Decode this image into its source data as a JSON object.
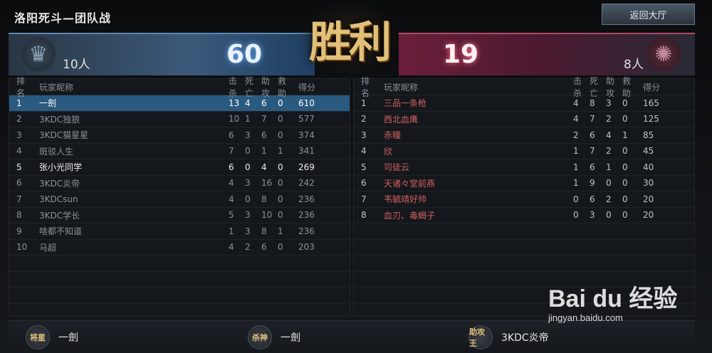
{
  "header": {
    "title": "洛阳死斗—团队战",
    "back_label": "返回大厅",
    "result": "胜利"
  },
  "teams": {
    "blue": {
      "players": "10人",
      "score": "60"
    },
    "red": {
      "players": "8人",
      "score": "19"
    }
  },
  "columns": {
    "rank": "排名",
    "name": "玩家昵称",
    "kills": "击杀",
    "deaths": "死亡",
    "assists": "助攻",
    "rescues": "救助",
    "score": "得分"
  },
  "blue_rows": [
    {
      "rank": "1",
      "name": "一劍",
      "k": "13",
      "d": "4",
      "a": "6",
      "r": "0",
      "s": "610"
    },
    {
      "rank": "2",
      "name": "3KDC独狼",
      "k": "10",
      "d": "1",
      "a": "7",
      "r": "0",
      "s": "577"
    },
    {
      "rank": "3",
      "name": "3KDC猫星星",
      "k": "6",
      "d": "3",
      "a": "6",
      "r": "0",
      "s": "374"
    },
    {
      "rank": "4",
      "name": "斑驳人生",
      "k": "7",
      "d": "0",
      "a": "1",
      "r": "1",
      "s": "341"
    },
    {
      "rank": "5",
      "name": "张小光同学",
      "k": "6",
      "d": "0",
      "a": "4",
      "r": "0",
      "s": "269"
    },
    {
      "rank": "6",
      "name": "3KDC炎帝",
      "k": "4",
      "d": "3",
      "a": "16",
      "r": "0",
      "s": "242"
    },
    {
      "rank": "7",
      "name": "3KDCsun",
      "k": "4",
      "d": "0",
      "a": "8",
      "r": "0",
      "s": "236"
    },
    {
      "rank": "8",
      "name": "3KDC学长",
      "k": "5",
      "d": "3",
      "a": "10",
      "r": "0",
      "s": "236"
    },
    {
      "rank": "9",
      "name": "啥都不知道",
      "k": "1",
      "d": "3",
      "a": "8",
      "r": "1",
      "s": "236"
    },
    {
      "rank": "10",
      "name": "马超",
      "k": "4",
      "d": "2",
      "a": "6",
      "r": "0",
      "s": "203"
    }
  ],
  "red_rows": [
    {
      "rank": "1",
      "name": "三品一条枪",
      "k": "4",
      "d": "8",
      "a": "3",
      "r": "0",
      "s": "165"
    },
    {
      "rank": "2",
      "name": "西北血鹰",
      "k": "4",
      "d": "7",
      "a": "2",
      "r": "0",
      "s": "125"
    },
    {
      "rank": "3",
      "name": "赤瞳",
      "k": "2",
      "d": "6",
      "a": "4",
      "r": "1",
      "s": "85"
    },
    {
      "rank": "4",
      "name": "欣",
      "k": "1",
      "d": "7",
      "a": "2",
      "r": "0",
      "s": "45"
    },
    {
      "rank": "5",
      "name": "司徒云",
      "k": "1",
      "d": "6",
      "a": "1",
      "r": "0",
      "s": "40"
    },
    {
      "rank": "6",
      "name": "天诸々堂前燕",
      "k": "1",
      "d": "9",
      "a": "0",
      "r": "0",
      "s": "30"
    },
    {
      "rank": "7",
      "name": "韦毓靖好帅",
      "k": "0",
      "d": "6",
      "a": "2",
      "r": "0",
      "s": "20"
    },
    {
      "rank": "8",
      "name": "血刃、毒蝎子",
      "k": "0",
      "d": "3",
      "a": "0",
      "r": "0",
      "s": "20"
    }
  ],
  "awards": [
    {
      "title": "将星",
      "player": "一劍"
    },
    {
      "title": "杀神",
      "player": "一劍"
    },
    {
      "title": "助攻王",
      "player": "3KDC炎帝"
    }
  ],
  "watermark": {
    "main": "Bai du 经验",
    "sub": "jingyan.baidu.com"
  }
}
